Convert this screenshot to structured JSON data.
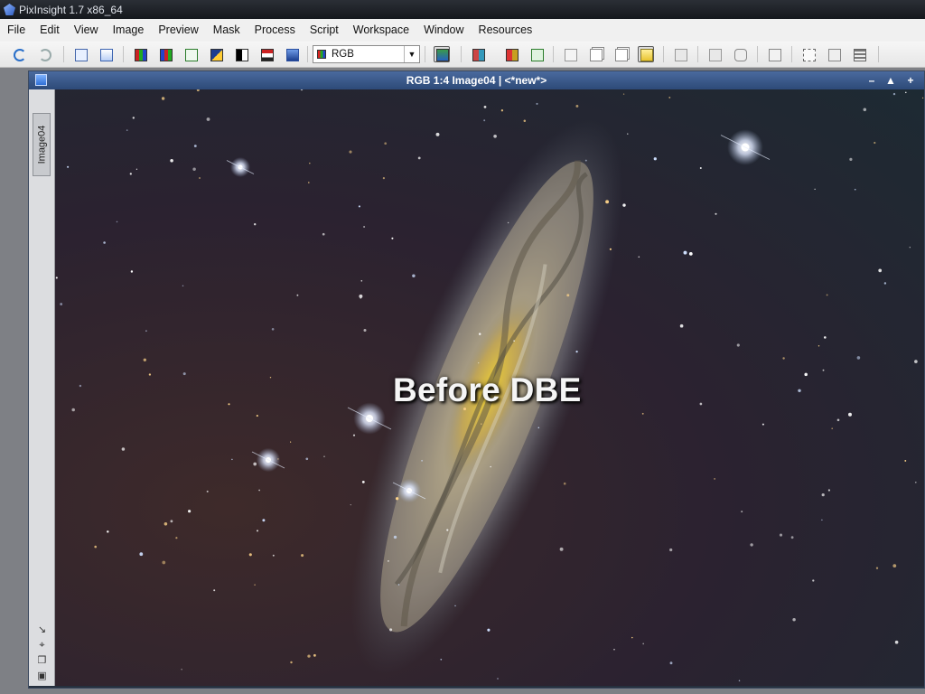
{
  "app": {
    "title": "PixInsight 1.7 x86_64"
  },
  "menu": [
    {
      "name": "menu-file",
      "label": "File"
    },
    {
      "name": "menu-edit",
      "label": "Edit"
    },
    {
      "name": "menu-view",
      "label": "View"
    },
    {
      "name": "menu-image",
      "label": "Image"
    },
    {
      "name": "menu-preview",
      "label": "Preview"
    },
    {
      "name": "menu-mask",
      "label": "Mask"
    },
    {
      "name": "menu-process",
      "label": "Process"
    },
    {
      "name": "menu-script",
      "label": "Script"
    },
    {
      "name": "menu-workspace",
      "label": "Workspace"
    },
    {
      "name": "menu-window",
      "label": "Window"
    },
    {
      "name": "menu-resources",
      "label": "Resources"
    }
  ],
  "toolbar": {
    "channel_select_value": "RGB",
    "icons": [
      "undo-icon",
      "redo-icon",
      "identifier-icon",
      "clone-image-icon",
      "rgb-channels-icon",
      "color-channels-icon",
      "new-preview-icon",
      "invert-icon",
      "mask-icon",
      "save-icon",
      "screen-transfer-icon",
      "channel-display-icon",
      "rgb-mask-icon",
      "show-mask-icon",
      "new-image-icon",
      "new-window-icon",
      "duplicate-icon",
      "copy-icon",
      "autostretch-icon",
      "zoom-in-icon",
      "zoom-out-icon",
      "pan-icon",
      "fit-view-icon",
      "crop-icon",
      "restore-icon",
      "settings-icon"
    ]
  },
  "image_window": {
    "title": "RGB 1:4 Image04 | <*new*>",
    "tab_label": "Image04",
    "overlay_text": "Before DBE",
    "controls": [
      "minimize-icon",
      "shade-icon",
      "maximize-icon"
    ]
  },
  "colors": {
    "window_title": "#3a5a8e",
    "titlebar": "#1c2026",
    "menubar": "#f0f0f0"
  }
}
